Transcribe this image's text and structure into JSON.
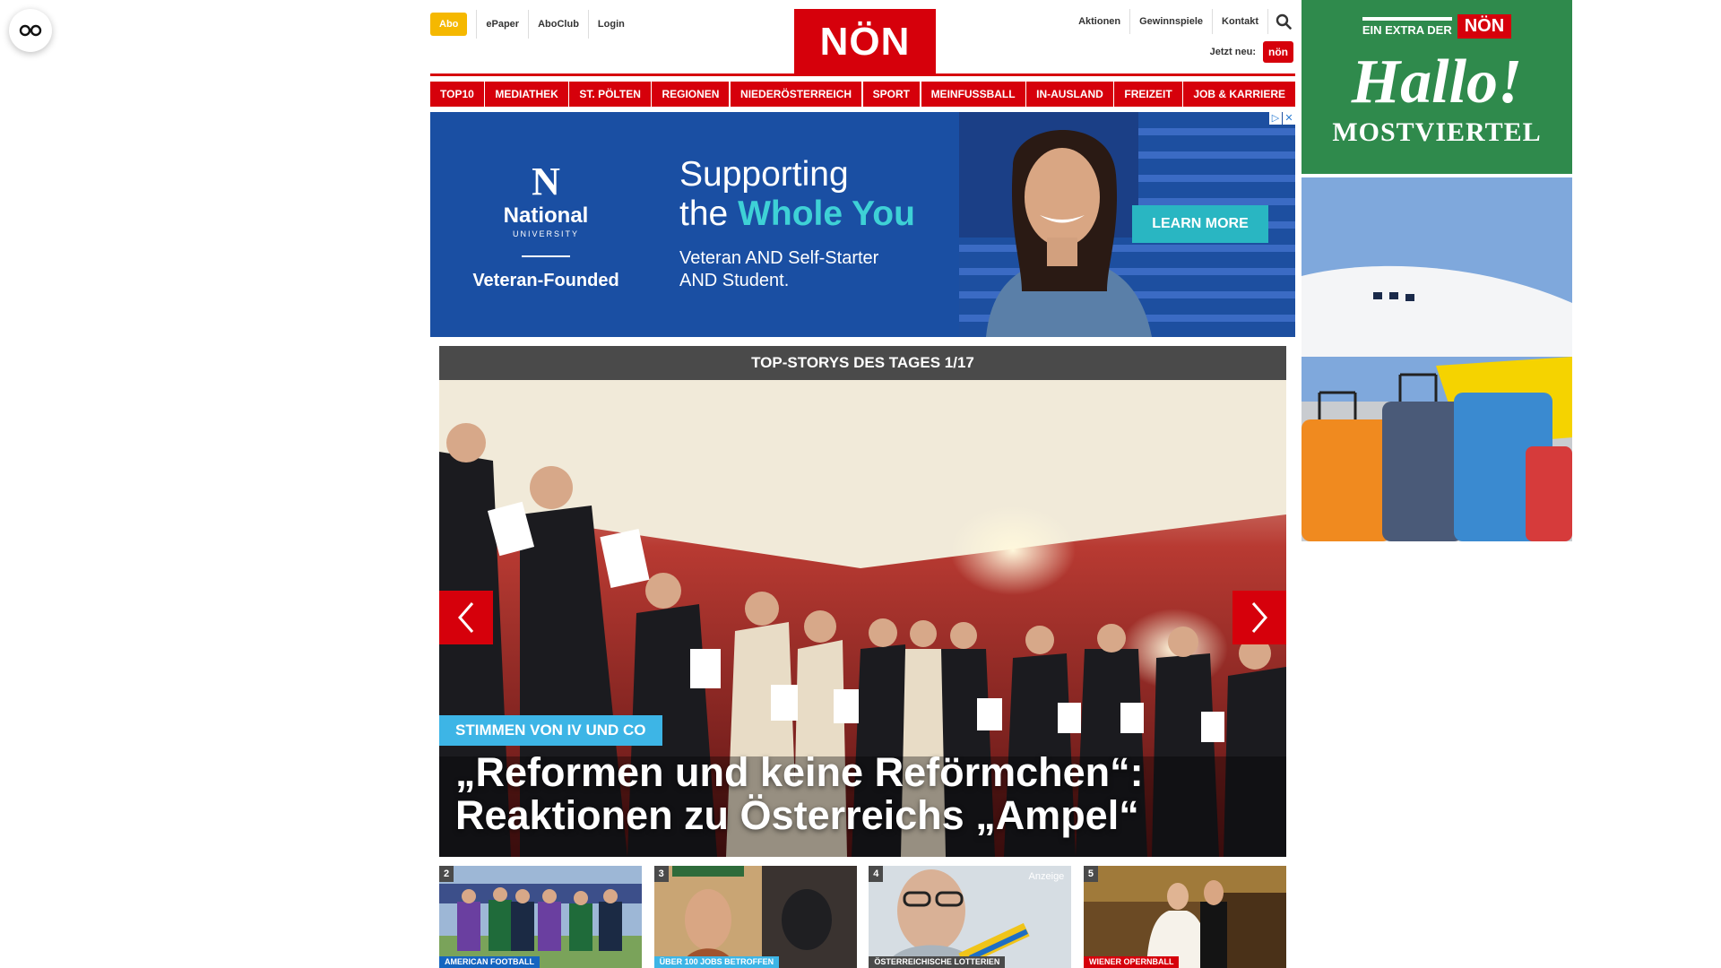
{
  "header": {
    "abo_label": "Abo",
    "left_links": [
      "ePaper",
      "AboClub",
      "Login"
    ],
    "logo_text": "NÖN",
    "right_links": [
      "Aktionen",
      "Gewinnspiele",
      "Kontakt"
    ],
    "jetzt_label": "Jetzt neu:",
    "jetzt_badge": "nön"
  },
  "nav": {
    "items": [
      "TOP10",
      "MEDIATHEK",
      "ST. PÖLTEN",
      "REGIONEN",
      "NIEDERÖSTERREICH",
      "SPORT",
      "MEINFUSSBALL",
      "IN-AUSLAND",
      "FREIZEIT",
      "JOB & KARRIERE"
    ]
  },
  "ad_banner": {
    "brand_name": "National",
    "brand_university": "UNIVERSITY",
    "brand_tagline": "Veteran-Founded",
    "headline_line1": "Supporting",
    "headline_line2_prefix": "the ",
    "headline_line2_accent": "Whole You",
    "sub_line1": "Veteran AND Self-Starter",
    "sub_line2": "AND Student.",
    "cta_label": "LEARN MORE"
  },
  "slider": {
    "header": "TOP-STORYS DES TAGES 1/17",
    "tag": "STIMMEN VON IV UND CO",
    "title": "„Reformen und keine Reförmchen“: Reaktionen zu Österreichs „Ampel“"
  },
  "teasers": [
    {
      "num": "2",
      "tag": "AMERICAN FOOTBALL",
      "tag_color": "#1565c0"
    },
    {
      "num": "3",
      "tag": "ÜBER 100 JOBS BETROFFEN",
      "tag_color": "#3db5e6"
    },
    {
      "num": "4",
      "tag": "ÖSTERREICHISCHE LOTTERIEN",
      "tag_color": "#4a4a4a",
      "badge": "Anzeige"
    },
    {
      "num": "5",
      "tag": "WIENER OPERNBALL",
      "tag_color": "#d6000b"
    }
  ],
  "sky_ad": {
    "extra_label": "EIN EXTRA DER",
    "non_label": "NÖN",
    "hallo": "Hallo!",
    "region": "MOSTVIERTEL"
  },
  "colors": {
    "brand_red": "#d6000b",
    "abo_yellow": "#f5b800",
    "slider_tag": "#3db5e6"
  }
}
